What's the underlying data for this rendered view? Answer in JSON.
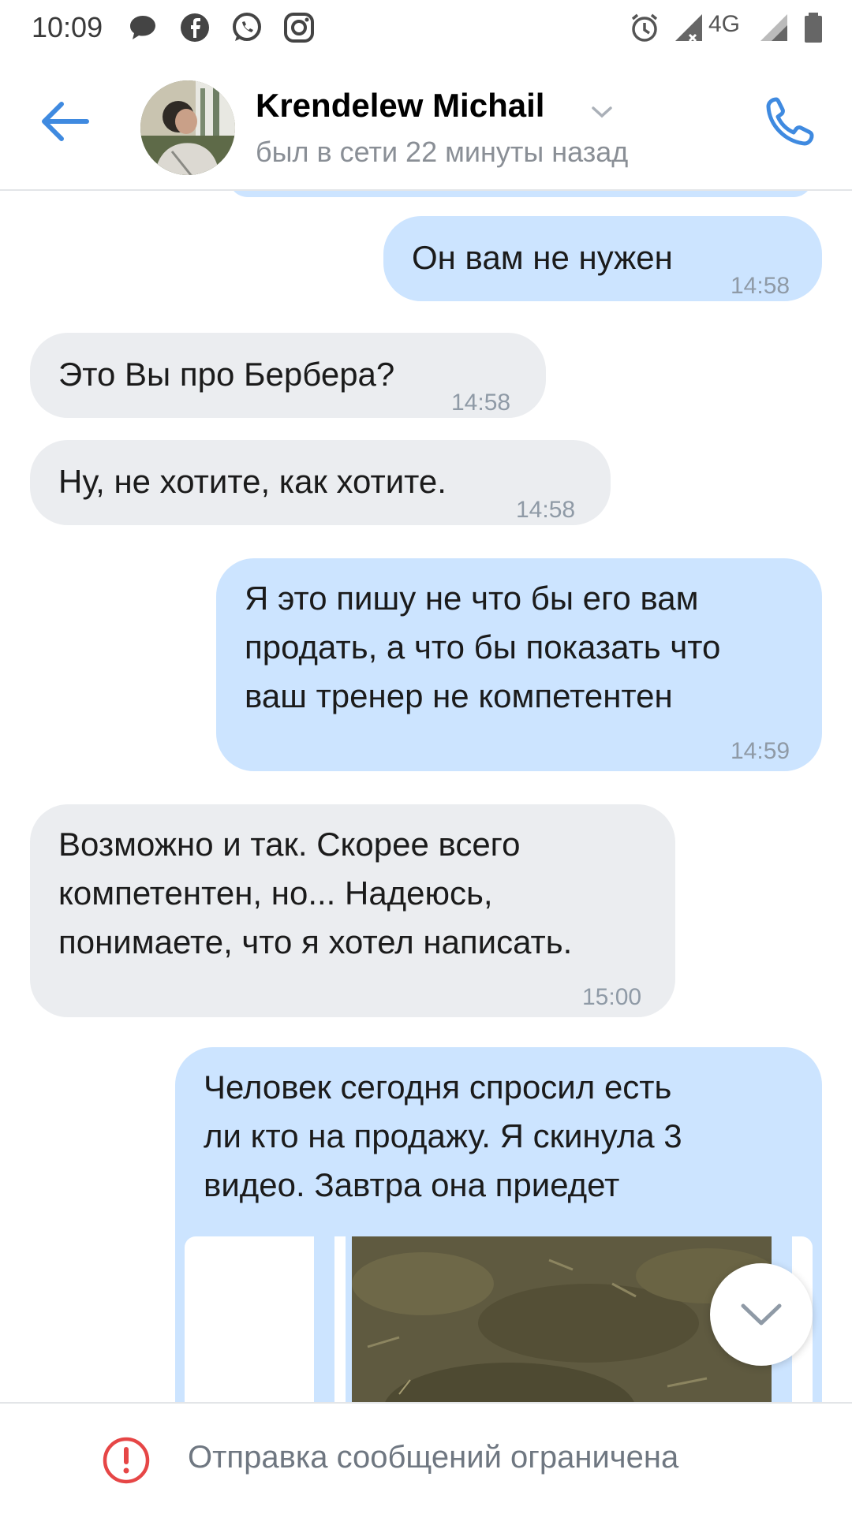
{
  "status_bar": {
    "time": "10:09",
    "network": "4G",
    "icons": [
      "chat-bubble-icon",
      "facebook-icon",
      "whatsapp-icon",
      "instagram-icon",
      "alarm-icon",
      "signal-icon",
      "battery-icon"
    ]
  },
  "header": {
    "contact_name": "Krendelew Michail",
    "last_seen": "был в сети 22 минуты назад",
    "icons": [
      "back-arrow-icon",
      "chevron-down-icon",
      "phone-icon"
    ]
  },
  "messages": [
    {
      "direction": "out",
      "text": "Он вам не нужен",
      "time": "14:58"
    },
    {
      "direction": "in",
      "text": "Это Вы про Бербера?",
      "time": "14:58"
    },
    {
      "direction": "in",
      "text": "Ну, не хотите, как хотите.",
      "time": "14:58"
    },
    {
      "direction": "out",
      "text": "Я это пишу не что бы его вам\nпродать, а что бы показать что\nваш тренер не компетентен",
      "time": "14:59"
    },
    {
      "direction": "in",
      "text": "Возможно и так. Скорее всего\nкомпетентен, но... Надеюсь,\nпонимаете, что я хотел написать.",
      "time": "15:00"
    },
    {
      "direction": "out",
      "text": "Человек сегодня спросил есть\nли кто на продажу. Я скинула 3\nвидео. Завтра она приедет",
      "time": ""
    }
  ],
  "footer": {
    "notice": "Отправка сообщений ограничена"
  },
  "colors": {
    "accent": "#3f8ae0",
    "outgoing_bubble": "#cce4ff",
    "incoming_bubble": "#ebedf0",
    "warning": "#e64646"
  }
}
